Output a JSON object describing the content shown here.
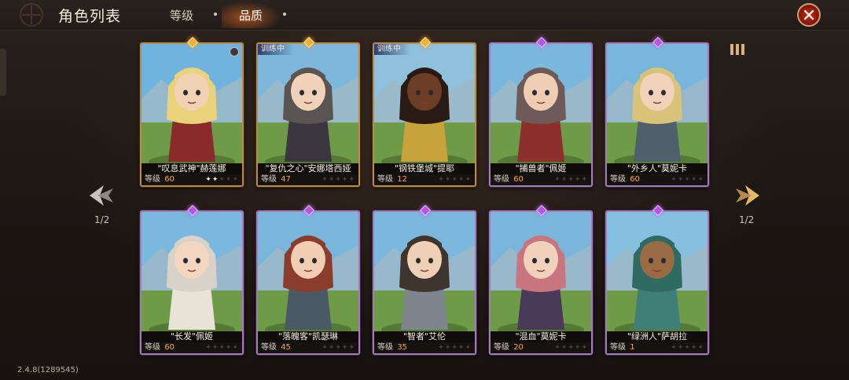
{
  "header": {
    "title": "角色列表",
    "tabs": [
      {
        "label": "等级",
        "active": false
      },
      {
        "label": "品质",
        "active": true
      }
    ]
  },
  "pagination": {
    "left": "1/2",
    "right": "1/2"
  },
  "version": "2.4.8(1289545)",
  "level_label": "等级",
  "status_tag": "训练中",
  "colors": {
    "gold_rarity": "#f2b12e",
    "purple_rarity": "#b15ae0",
    "level_value": "#f0a641",
    "close_button": "#c52a18"
  },
  "cards": [
    {
      "name": "\"叹息武神\"赫莲娜",
      "level": "60",
      "rarity": "gold",
      "stars": 2,
      "training": false,
      "badge": true,
      "palette": {
        "sky": "#6fb3de",
        "hair": "#e9d27a",
        "cloth": "#8a2a2a",
        "skin": "#f1d1b4"
      }
    },
    {
      "name": "\"复仇之心\"安娜塔西娅",
      "level": "47",
      "rarity": "gold",
      "stars": 0,
      "training": true,
      "badge": false,
      "palette": {
        "sky": "#7db8dc",
        "hair": "#5a5552",
        "cloth": "#3b3640",
        "skin": "#f0d2bb"
      }
    },
    {
      "name": "\"钢铁堡城\"提耶",
      "level": "12",
      "rarity": "gold",
      "stars": 0,
      "training": true,
      "badge": false,
      "palette": {
        "sky": "#8fc0dc",
        "hair": "#2a1a14",
        "cloth": "#c8a23a",
        "skin": "#6b3e25"
      }
    },
    {
      "name": "\"捕兽者\"佩姬",
      "level": "60",
      "rarity": "purple",
      "stars": 0,
      "training": false,
      "badge": false,
      "palette": {
        "sky": "#7ab7dd",
        "hair": "#6e5a58",
        "cloth": "#8d2f2c",
        "skin": "#efcdb5"
      }
    },
    {
      "name": "\"外乡人\"莫妮卡",
      "level": "60",
      "rarity": "purple",
      "stars": 0,
      "training": false,
      "badge": false,
      "palette": {
        "sky": "#78b6dd",
        "hair": "#d9c37a",
        "cloth": "#4f5f6b",
        "skin": "#f1d3bc"
      }
    },
    {
      "name": "\"长发\"佩姬",
      "level": "60",
      "rarity": "purple",
      "stars": 0,
      "training": false,
      "badge": false,
      "palette": {
        "sky": "#7bb8df",
        "hair": "#d8d2c8",
        "cloth": "#e8e3d6",
        "skin": "#f2d6c2"
      }
    },
    {
      "name": "\"落魄客\"凯瑟琳",
      "level": "45",
      "rarity": "purple",
      "stars": 0,
      "training": false,
      "badge": false,
      "palette": {
        "sky": "#79b6dc",
        "hair": "#8a3d2c",
        "cloth": "#4b5866",
        "skin": "#f0cdb3"
      }
    },
    {
      "name": "\"智者\"艾伦",
      "level": "35",
      "rarity": "purple",
      "stars": 0,
      "training": false,
      "badge": false,
      "palette": {
        "sky": "#7cb8de",
        "hair": "#3f352f",
        "cloth": "#7f858c",
        "skin": "#efcfb6"
      }
    },
    {
      "name": "\"混血\"莫妮卡",
      "level": "20",
      "rarity": "purple",
      "stars": 0,
      "training": false,
      "badge": false,
      "palette": {
        "sky": "#7ab5dc",
        "hair": "#c9757d",
        "cloth": "#4a3a5a",
        "skin": "#f1d0bd"
      }
    },
    {
      "name": "\"绿洲人\"萨胡拉",
      "level": "1",
      "rarity": "purple",
      "stars": 0,
      "training": false,
      "badge": false,
      "palette": {
        "sky": "#86bfe0",
        "hair": "#2f6b63",
        "cloth": "#3f7f78",
        "skin": "#9a6a45"
      }
    }
  ]
}
